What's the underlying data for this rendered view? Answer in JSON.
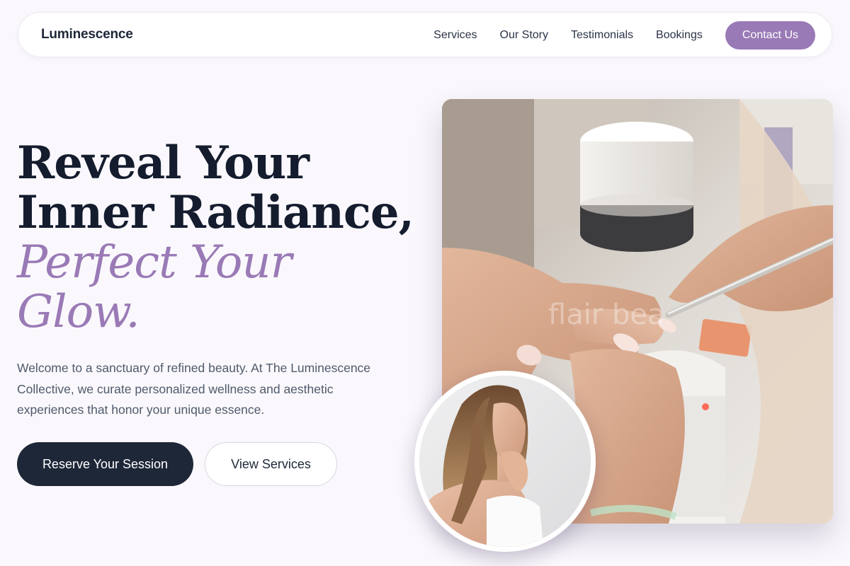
{
  "nav": {
    "brand": "Luminescence",
    "links": [
      "Services",
      "Our Story",
      "Testimonials",
      "Bookings"
    ],
    "cta": "Contact Us"
  },
  "hero": {
    "title_line1": "Reveal Your",
    "title_line2": "Inner Radiance,",
    "title_accent_line1": "Perfect Your",
    "title_accent_line2": "Glow.",
    "description": "Welcome to a sanctuary of refined beauty. At The Luminescence Collective, we curate personalized wellness and aesthetic experiences that honor your unique essence.",
    "primary_cta": "Reserve Your Session",
    "secondary_cta": "View Services"
  },
  "images": {
    "main_photo_watermark": "flair bea"
  },
  "colors": {
    "accent": "#9a7ab6",
    "dark": "#1e2738",
    "background": "#faf8fc"
  }
}
